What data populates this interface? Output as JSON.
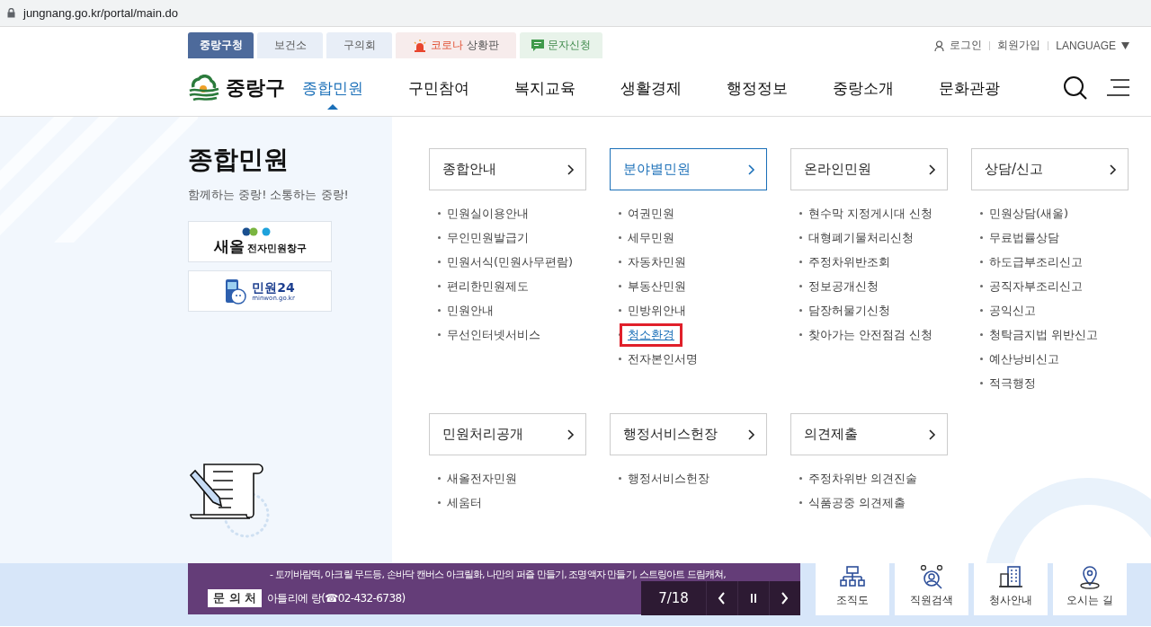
{
  "address_bar": {
    "url": "jungnang.go.kr/portal/main.do"
  },
  "site_tabs": [
    {
      "kind": "plain",
      "label": "중랑구청",
      "selected": true
    },
    {
      "kind": "plain",
      "label": "보건소",
      "selected": false
    },
    {
      "kind": "plain",
      "label": "구의회",
      "selected": false
    },
    {
      "kind": "alert",
      "accent": "코로나",
      "label": "상황판",
      "selected": false
    },
    {
      "kind": "message",
      "label": "문자신청",
      "selected": false
    }
  ],
  "utility_links": [
    "로그인",
    "회원가입",
    "LANGUAGE"
  ],
  "logo": {
    "text": "중랑구"
  },
  "nav": [
    {
      "label": "종합민원",
      "selected": true
    },
    {
      "label": "구민참여",
      "selected": false
    },
    {
      "label": "복지교육",
      "selected": false
    },
    {
      "label": "생활경제",
      "selected": false
    },
    {
      "label": "행정정보",
      "selected": false
    },
    {
      "label": "중랑소개",
      "selected": false
    },
    {
      "label": "문화관광",
      "selected": false
    }
  ],
  "side": {
    "title": "종합민원",
    "slogan": "함께하는 중랑! 소통하는 중랑!",
    "banners": [
      {
        "kind": "saeol",
        "title": "새올",
        "subtitle": "전자민원창구"
      },
      {
        "kind": "minwon24",
        "title": "민원24",
        "subtitle": "minwon.go.kr"
      }
    ]
  },
  "menu_groups": [
    {
      "title": "종합안내",
      "selected": false,
      "items": [
        {
          "label": "민원실이용안내",
          "highlighted": false
        },
        {
          "label": "무인민원발급기",
          "highlighted": false
        },
        {
          "label": "민원서식(민원사무편람)",
          "highlighted": false
        },
        {
          "label": "편리한민원제도",
          "highlighted": false
        },
        {
          "label": "민원안내",
          "highlighted": false
        },
        {
          "label": "무선인터넷서비스",
          "highlighted": false
        }
      ]
    },
    {
      "title": "분야별민원",
      "selected": true,
      "items": [
        {
          "label": "여권민원",
          "highlighted": false
        },
        {
          "label": "세무민원",
          "highlighted": false
        },
        {
          "label": "자동차민원",
          "highlighted": false
        },
        {
          "label": "부동산민원",
          "highlighted": false
        },
        {
          "label": "민방위안내",
          "highlighted": false
        },
        {
          "label": "청소환경",
          "highlighted": true
        },
        {
          "label": "전자본인서명",
          "highlighted": false
        }
      ]
    },
    {
      "title": "온라인민원",
      "selected": false,
      "items": [
        {
          "label": "현수막 지정게시대 신청",
          "highlighted": false
        },
        {
          "label": "대형폐기물처리신청",
          "highlighted": false
        },
        {
          "label": "주정차위반조회",
          "highlighted": false
        },
        {
          "label": "정보공개신청",
          "highlighted": false
        },
        {
          "label": "담장허물기신청",
          "highlighted": false
        },
        {
          "label": "찾아가는 안전점검 신청",
          "highlighted": false
        }
      ]
    },
    {
      "title": "상담/신고",
      "selected": false,
      "items": [
        {
          "label": "민원상담(새울)",
          "highlighted": false
        },
        {
          "label": "무료법률상담",
          "highlighted": false
        },
        {
          "label": "하도급부조리신고",
          "highlighted": false
        },
        {
          "label": "공직자부조리신고",
          "highlighted": false
        },
        {
          "label": "공익신고",
          "highlighted": false
        },
        {
          "label": "청탁금지법 위반신고",
          "highlighted": false
        },
        {
          "label": "예산낭비신고",
          "highlighted": false
        },
        {
          "label": "적극행정",
          "highlighted": false
        }
      ]
    },
    {
      "title": "민원처리공개",
      "selected": false,
      "items": [
        {
          "label": "새올전자민원",
          "highlighted": false
        },
        {
          "label": "세움터",
          "highlighted": false
        }
      ]
    },
    {
      "title": "행정서비스헌장",
      "selected": false,
      "items": [
        {
          "label": "행정서비스헌장",
          "highlighted": false
        }
      ]
    },
    {
      "title": "의견제출",
      "selected": false,
      "items": [
        {
          "label": "주정차위반 의견진술",
          "highlighted": false
        },
        {
          "label": "식품공중 의견제출",
          "highlighted": false
        }
      ]
    }
  ],
  "notice_banner": {
    "label": "문 의 처",
    "lines": [
      "- 토끼바람떡, 아크릴 무드등, 손바닥 캔버스 아크릴화, 나만의 퍼즐 만들기, 조명액자 만들기, 스트링아트 드림캐쳐,",
      "아틀리에 랑(☎02-432-6738)"
    ],
    "counter": "7/18"
  },
  "quick_links": [
    {
      "kind": "org",
      "label": "조직도"
    },
    {
      "kind": "staff",
      "label": "직원검색"
    },
    {
      "kind": "building",
      "label": "청사안내"
    },
    {
      "kind": "map",
      "label": "오시는 길"
    }
  ]
}
